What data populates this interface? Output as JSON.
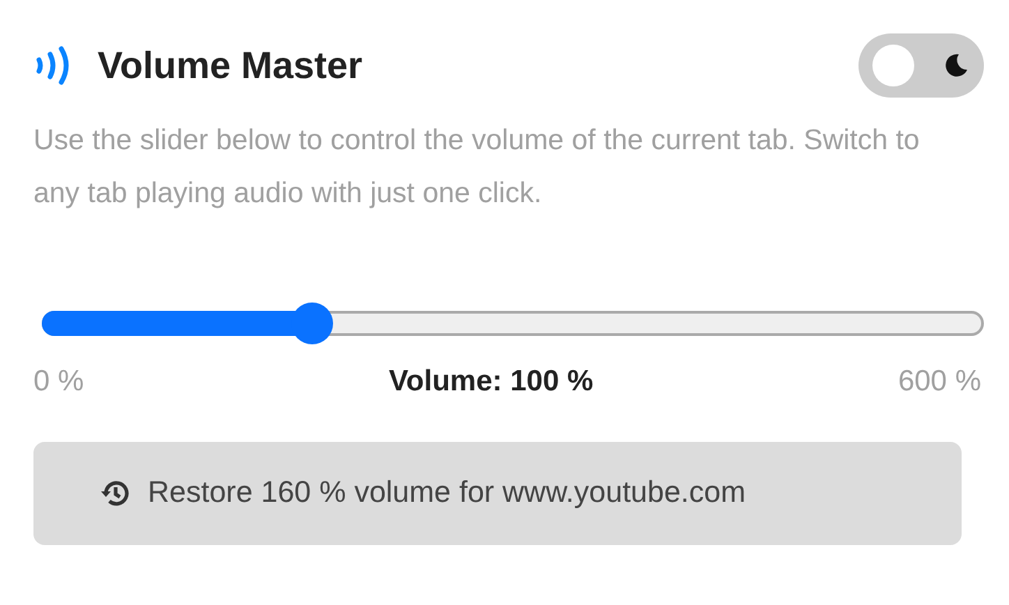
{
  "header": {
    "title": "Volume Master",
    "dark_mode_toggle": {
      "on": false
    }
  },
  "description": "Use the slider below to control the volume of the current tab. Switch to any tab playing audio with just one click.",
  "slider": {
    "level": 0.287,
    "min_label": "0 %",
    "reading": "Volume: 100 %",
    "max_label": "600 %"
  },
  "restore_button": {
    "label": "Restore 160 % volume for www.youtube.com"
  }
}
